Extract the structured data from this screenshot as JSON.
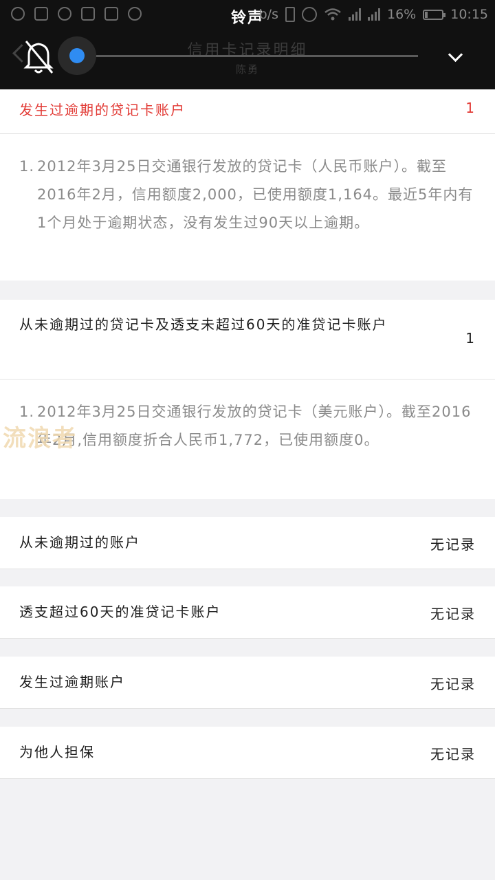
{
  "status_bar": {
    "title": "铃声",
    "network_speed": "b/s",
    "battery_percent": "16%",
    "time": "10:15"
  },
  "header": {
    "title": "信用卡记录明细",
    "subtitle": "陈勇",
    "back_hint": "返"
  },
  "volume_panel": {
    "level": 0.0
  },
  "overdue_section": {
    "label": "发生过逾期的贷记卡账户",
    "count": "1",
    "item_number": "1.",
    "item_text": "2012年3月25日交通银行发放的贷记卡（人民币账户）。截至2016年2月，信用额度2,000，已使用额度1,164。最近5年内有1个月处于逾期状态，没有发生过90天以上逾期。"
  },
  "never_overdue_section": {
    "label": "从未逾期过的贷记卡及透支未超过60天的准贷记卡账户",
    "count": "1",
    "item_number": "1.",
    "item_text": "2012年3月25日交通银行发放的贷记卡（美元账户）。截至2016年2月,信用额度折合人民币1,772，已使用额度0。"
  },
  "watermark": "流浪者",
  "summary_rows": [
    {
      "label": "从未逾期过的账户",
      "value": "无记录"
    },
    {
      "label": "透支超过60天的准贷记卡账户",
      "value": "无记录"
    },
    {
      "label": "发生过逾期账户",
      "value": "无记录"
    },
    {
      "label": "为他人担保",
      "value": "无记录"
    }
  ]
}
